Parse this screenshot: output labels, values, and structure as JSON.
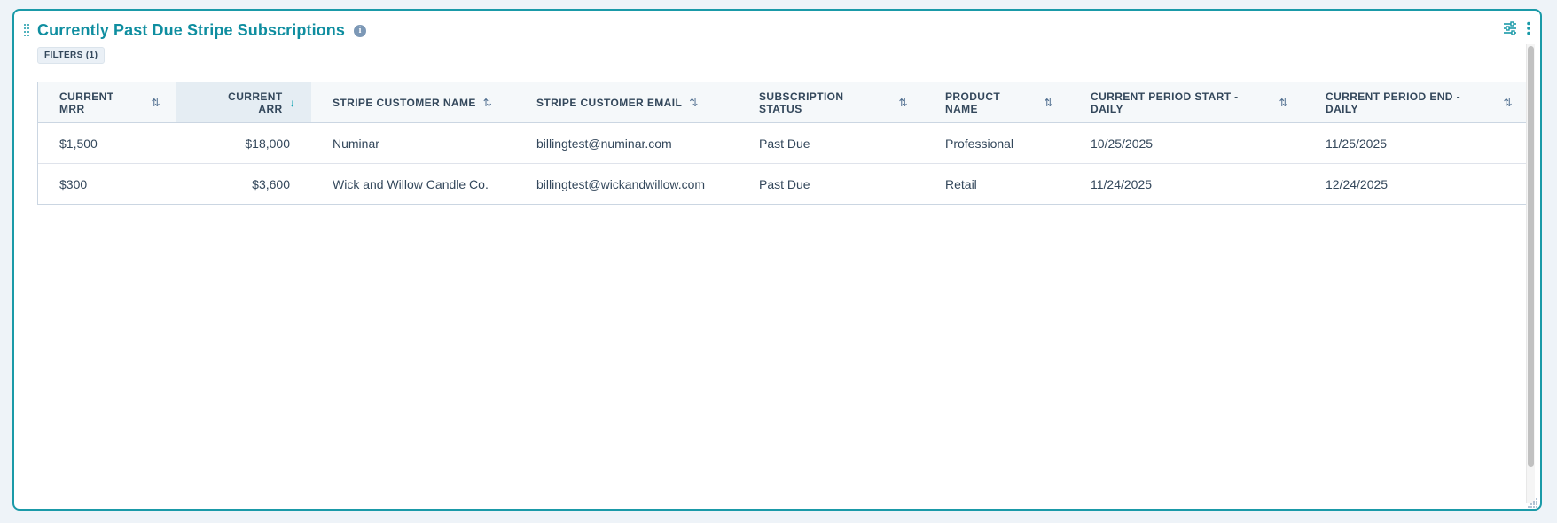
{
  "report": {
    "title": "Currently Past Due Stripe Subscriptions",
    "filters_label": "FILTERS (1)"
  },
  "icons": {
    "info": "info-icon",
    "settings": "sliders-icon",
    "menu": "more-vertical-icon",
    "sort": "sort-icon",
    "sort_active": "sort-descending-icon"
  },
  "colors": {
    "accent": "#1a9aa8",
    "title": "#0f8ea0",
    "text": "#33475b"
  },
  "table": {
    "columns": [
      {
        "line1": "CURRENT",
        "line2": "MRR"
      },
      {
        "line1": "CURRENT",
        "line2": "ARR"
      },
      {
        "line1": "STRIPE CUSTOMER NAME",
        "line2": ""
      },
      {
        "line1": "STRIPE CUSTOMER EMAIL",
        "line2": ""
      },
      {
        "line1": "SUBSCRIPTION",
        "line2": "STATUS"
      },
      {
        "line1": "PRODUCT",
        "line2": "NAME"
      },
      {
        "line1": "CURRENT PERIOD START -",
        "line2": "DAILY"
      },
      {
        "line1": "CURRENT PERIOD END -",
        "line2": "DAILY"
      }
    ],
    "rows": [
      [
        "$1,500",
        "$18,000",
        "Numinar",
        "billingtest@numinar.com",
        "Past Due",
        "Professional",
        "10/25/2025",
        "11/25/2025"
      ],
      [
        "$300",
        "$3,600",
        "Wick and Willow Candle Co.",
        "billingtest@wickandwillow.com",
        "Past Due",
        "Retail",
        "11/24/2025",
        "12/24/2025"
      ]
    ]
  }
}
